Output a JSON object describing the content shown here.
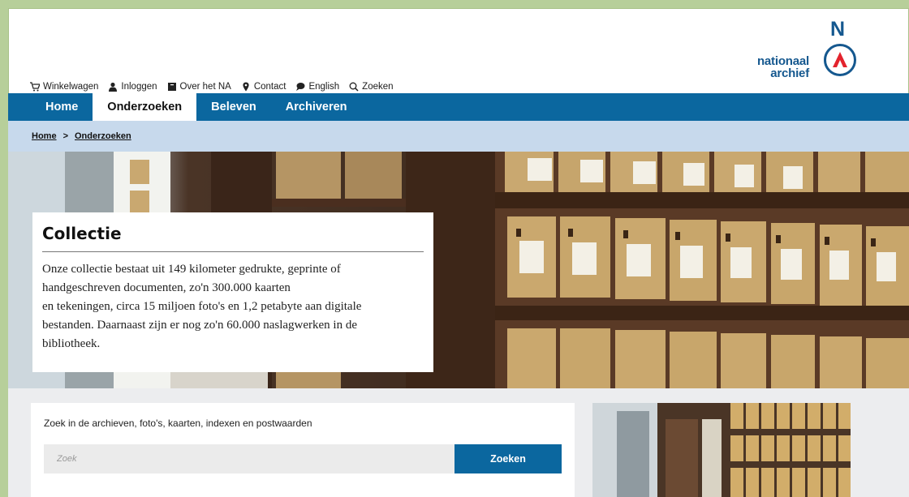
{
  "util_nav": [
    {
      "label": "Winkelwagen",
      "icon": "cart-icon"
    },
    {
      "label": "Inloggen",
      "icon": "user-icon"
    },
    {
      "label": "Over het NA",
      "icon": "book-icon"
    },
    {
      "label": "Contact",
      "icon": "map-pin-icon"
    },
    {
      "label": "English",
      "icon": "speech-bubble-icon"
    },
    {
      "label": "Zoeken",
      "icon": "search-icon"
    }
  ],
  "logo": {
    "line1": "nationaal",
    "line2": "archief",
    "letter": "N"
  },
  "main_nav": {
    "items": [
      {
        "label": "Home"
      },
      {
        "label": "Onderzoeken",
        "active": true
      },
      {
        "label": "Beleven"
      },
      {
        "label": "Archiveren"
      }
    ]
  },
  "breadcrumb": {
    "home": "Home",
    "separator": ">",
    "current": "Onderzoeken"
  },
  "hero": {
    "title": "Collectie",
    "lines": [
      "Onze collectie bestaat uit 149 kilometer gedrukte, geprinte of",
      "handgeschreven documenten, zo'n 300.000 kaarten",
      "en tekeningen, circa 15 miljoen foto's en 1,2 petabyte aan digitale",
      "bestanden. Daarnaast zijn er nog zo'n 60.000 naslagwerken in de",
      "bibliotheek."
    ]
  },
  "search": {
    "label": "Zoek in de archieven, foto's, kaarten, indexen en postwaarden",
    "placeholder": "Zoek",
    "button": "Zoeken"
  },
  "colors": {
    "nav_blue": "#0b679f",
    "breadcrumb_bg": "#c7d9ec",
    "logo_blue": "#15588f",
    "logo_red": "#e3232d",
    "frame_green": "#b7cf9a"
  }
}
